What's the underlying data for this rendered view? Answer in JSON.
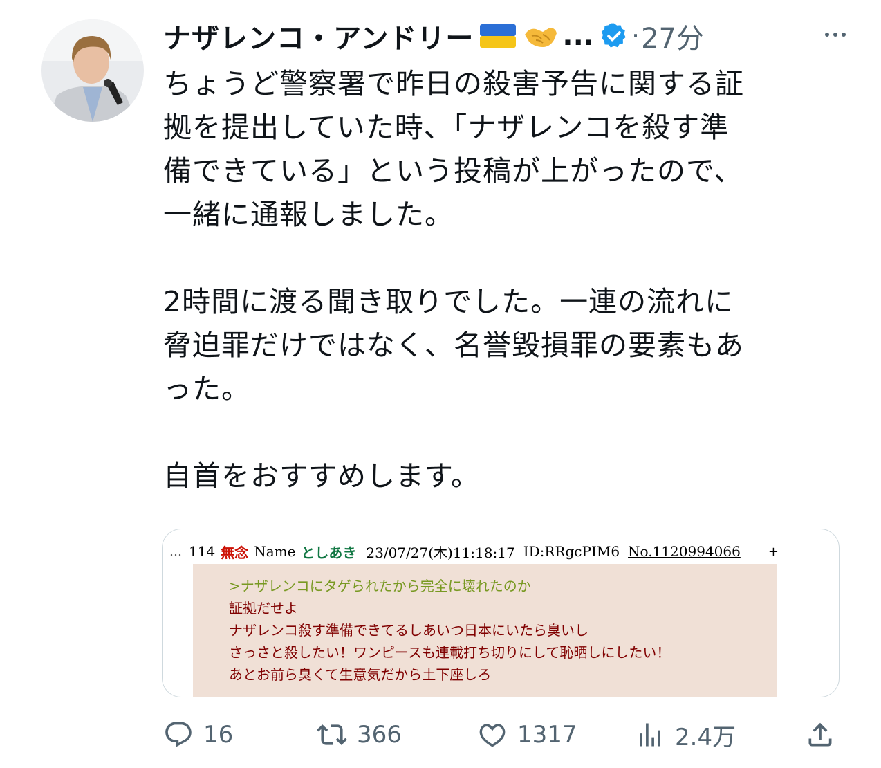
{
  "tweet": {
    "author": {
      "name": "ナザレンコ・アンドリー",
      "name_ellipsis": "...",
      "flag_icon": "ukraine-flag-icon",
      "emoji_icon": "handshake-icon",
      "verified_icon": "verified-badge-icon"
    },
    "dot": "·",
    "time": "27分",
    "text": {
      "p1": [
        "ちょうど警察署で昨日の殺害予告に関する証",
        "拠を提出していた時、「ナザレンコを殺す準",
        "備できている」という投稿が上がったので、",
        "一緒に通報しました。"
      ],
      "p2": [
        "2時間に渡る聞き取りでした。一連の流れに",
        "脅迫罪だけではなく、名誉毀損罪の要素もあ",
        "った。"
      ],
      "p3": [
        "自首をおすすめします。"
      ]
    },
    "media": {
      "header": {
        "dots": "…",
        "number": "114",
        "mu": "無念",
        "name_label": "Name",
        "poster": "としあき",
        "date": "23/07/27(木)11:18:17",
        "id": "ID:RRgcPIM6",
        "post_no": "No.1120994066",
        "plus": "+"
      },
      "lines": [
        ">ナザレンコにタゲられたから完全に壊れたのか",
        "証拠だせよ",
        "ナザレンコ殺す準備できてるしあいつ日本にいたら臭いし",
        "さっさと殺したい！ワンピースも連載打ち切りにして恥晒しにしたい！",
        "あとお前ら臭くて生意気だから土下座しろ"
      ]
    },
    "actions": {
      "replies": "16",
      "retweets": "366",
      "likes": "1317",
      "views": "2.4万"
    }
  },
  "colors": {
    "text": "#0f1419",
    "secondary": "#536471",
    "verified": "#1d9bf0",
    "post_bg": "#f0e0d6",
    "post_text": "#800000",
    "quote_text": "#789922",
    "mu_red": "#cc1105",
    "poster_green": "#117743"
  }
}
